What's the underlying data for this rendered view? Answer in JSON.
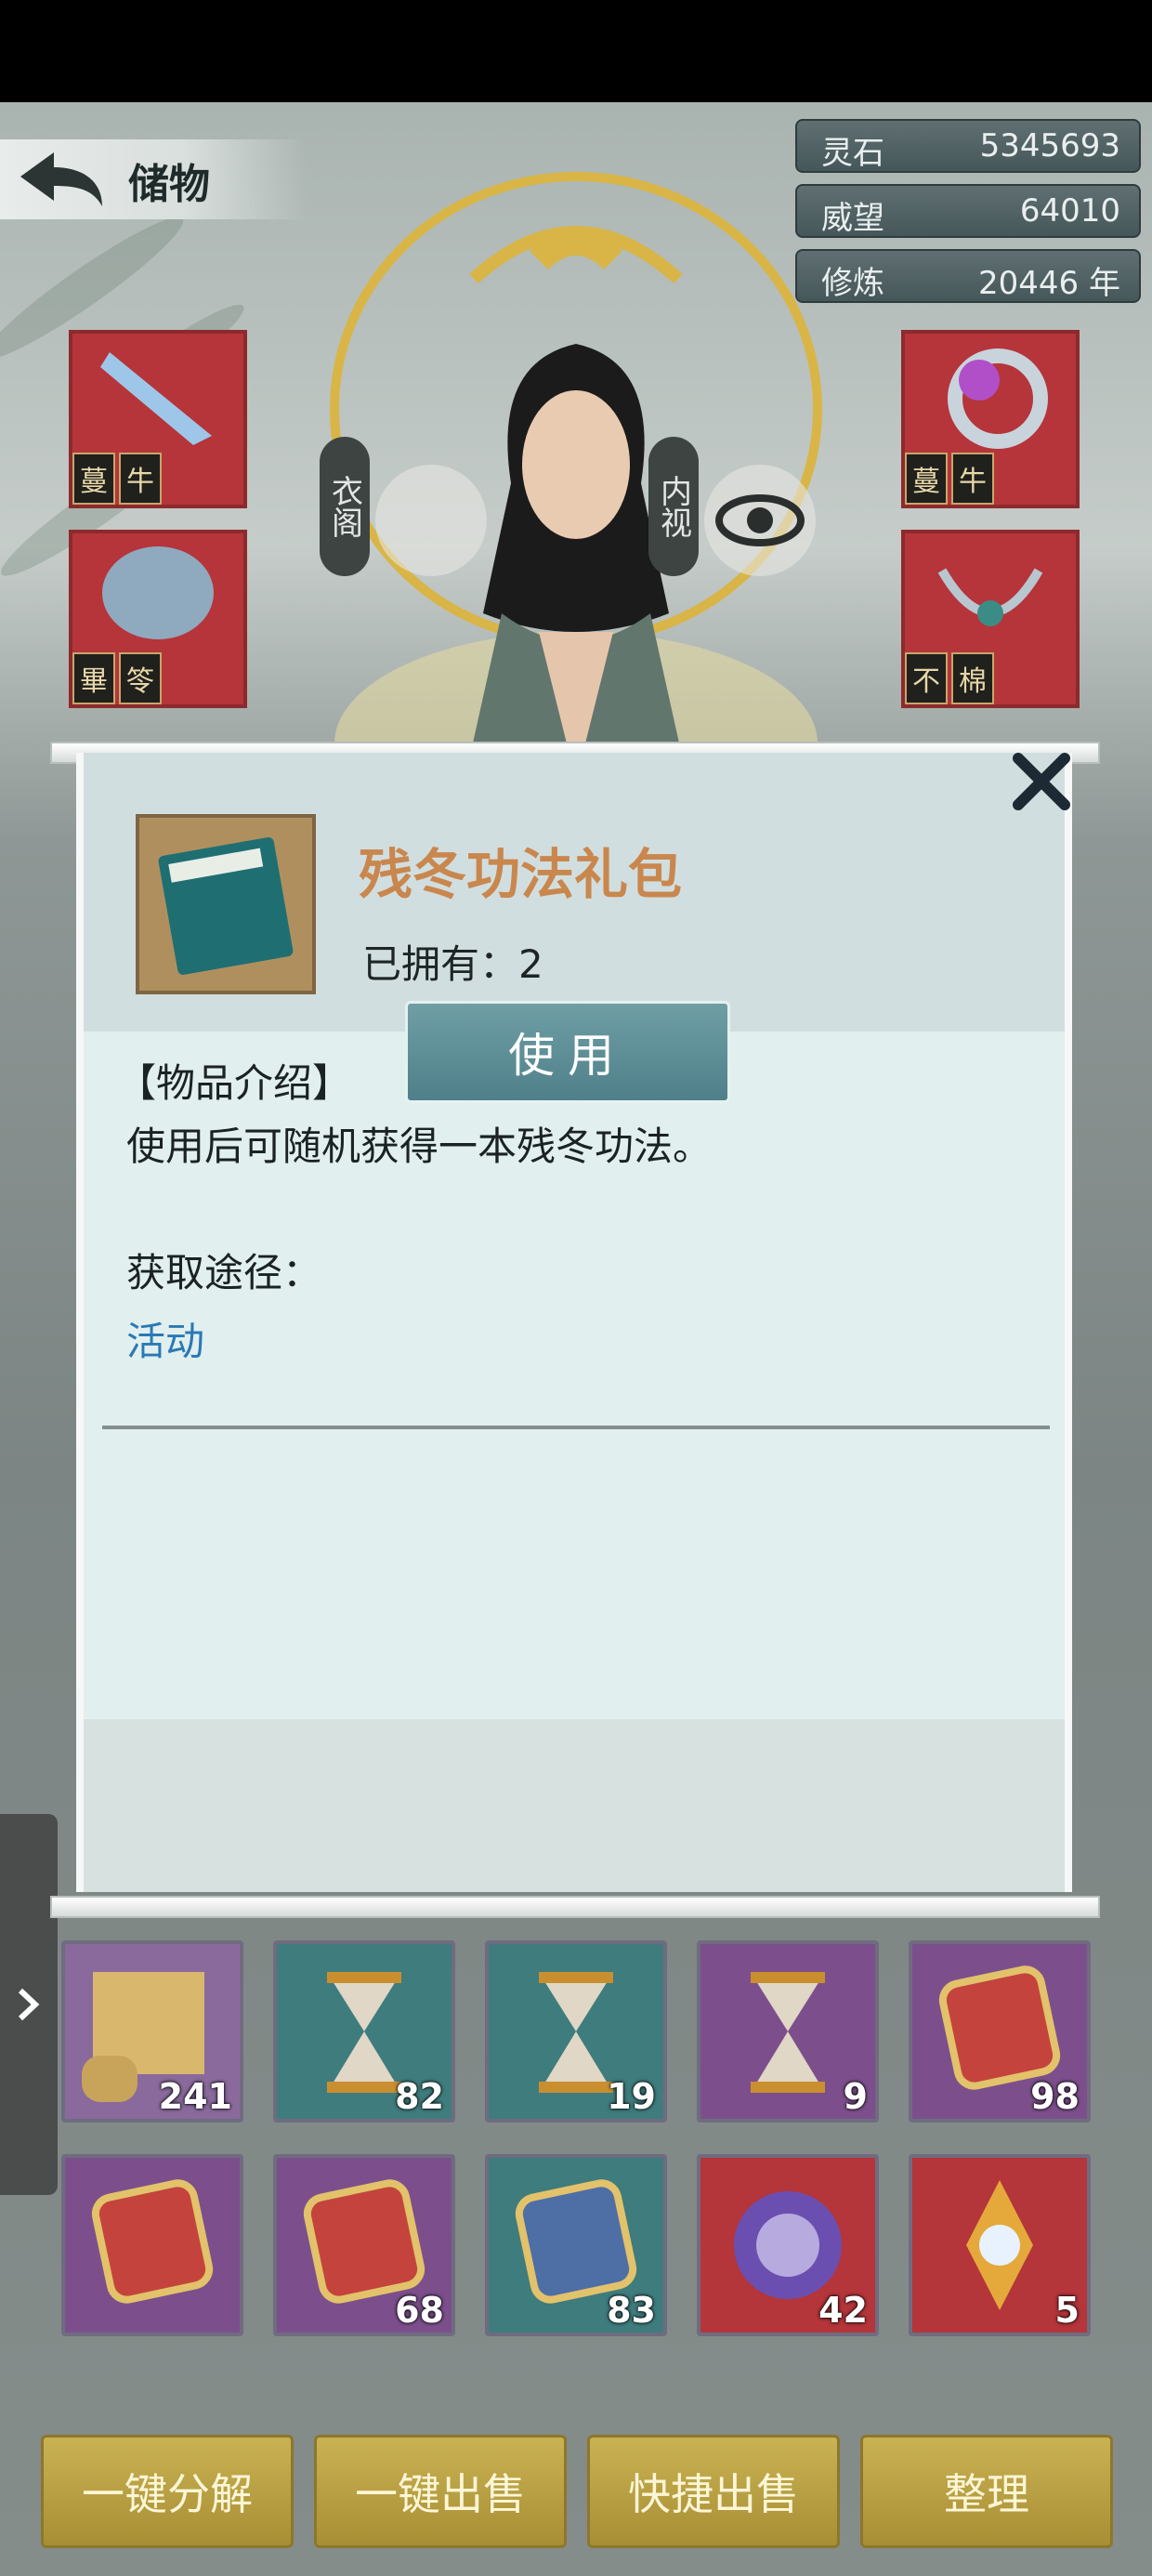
{
  "header": {
    "title": "储物"
  },
  "resources": [
    {
      "label": "灵石",
      "value": "5345693"
    },
    {
      "label": "威望",
      "value": "64010"
    },
    {
      "label": "修炼",
      "value": "20446 年"
    }
  ],
  "character": {
    "left_tab": "衣阁",
    "right_tab": "内视"
  },
  "equipment": {
    "left": [
      {
        "tag": [
          "蔓",
          "牛"
        ]
      },
      {
        "tag": [
          "畢",
          "笭"
        ]
      }
    ],
    "right": [
      {
        "tag": [
          "蔓",
          "牛"
        ]
      },
      {
        "tag": [
          "不",
          "棉"
        ]
      }
    ]
  },
  "dialog": {
    "item_name": "残冬功法礼包",
    "owned": "已拥有：2",
    "intro_title": "【物品介绍】",
    "intro_text": "使用后可随机获得一本残冬功法。",
    "source_title": "获取途径：",
    "source_link": "活动",
    "use_label": "使用",
    "close_icon": "close-x-icon"
  },
  "inventory": {
    "row1": [
      {
        "icon": "scroll-icon",
        "count": "241",
        "bg": "#8a6a9c"
      },
      {
        "icon": "hourglass-icon",
        "count": "82",
        "bg": "#3f7c7d"
      },
      {
        "icon": "hourglass-icon",
        "count": "19",
        "bg": "#3f7c7d"
      },
      {
        "icon": "hourglass-icon",
        "count": "9",
        "bg": "#7c4f8c"
      },
      {
        "icon": "token-hunt-icon",
        "count": "98",
        "bg": "#7c4f8c"
      }
    ],
    "row2": [
      {
        "icon": "token-travel-icon",
        "count": "",
        "bg": "#7c4f8c"
      },
      {
        "icon": "token-cultivate-icon",
        "count": "68",
        "bg": "#7c4f8c"
      },
      {
        "icon": "token-cultivate-blue-icon",
        "count": "83",
        "bg": "#3f7c7d"
      },
      {
        "icon": "meditation-orb-icon",
        "count": "42",
        "bg": "#b4353a"
      },
      {
        "icon": "crystal-icon",
        "count": "5",
        "bg": "#b4353a"
      }
    ]
  },
  "bottom_buttons": [
    "一键分解",
    "一键出售",
    "快捷出售",
    "整理"
  ],
  "colors": {
    "item_name": "#c9874e",
    "link": "#2a79b4",
    "gold_button": "#c9b254",
    "use_button": "#5a8b94"
  }
}
